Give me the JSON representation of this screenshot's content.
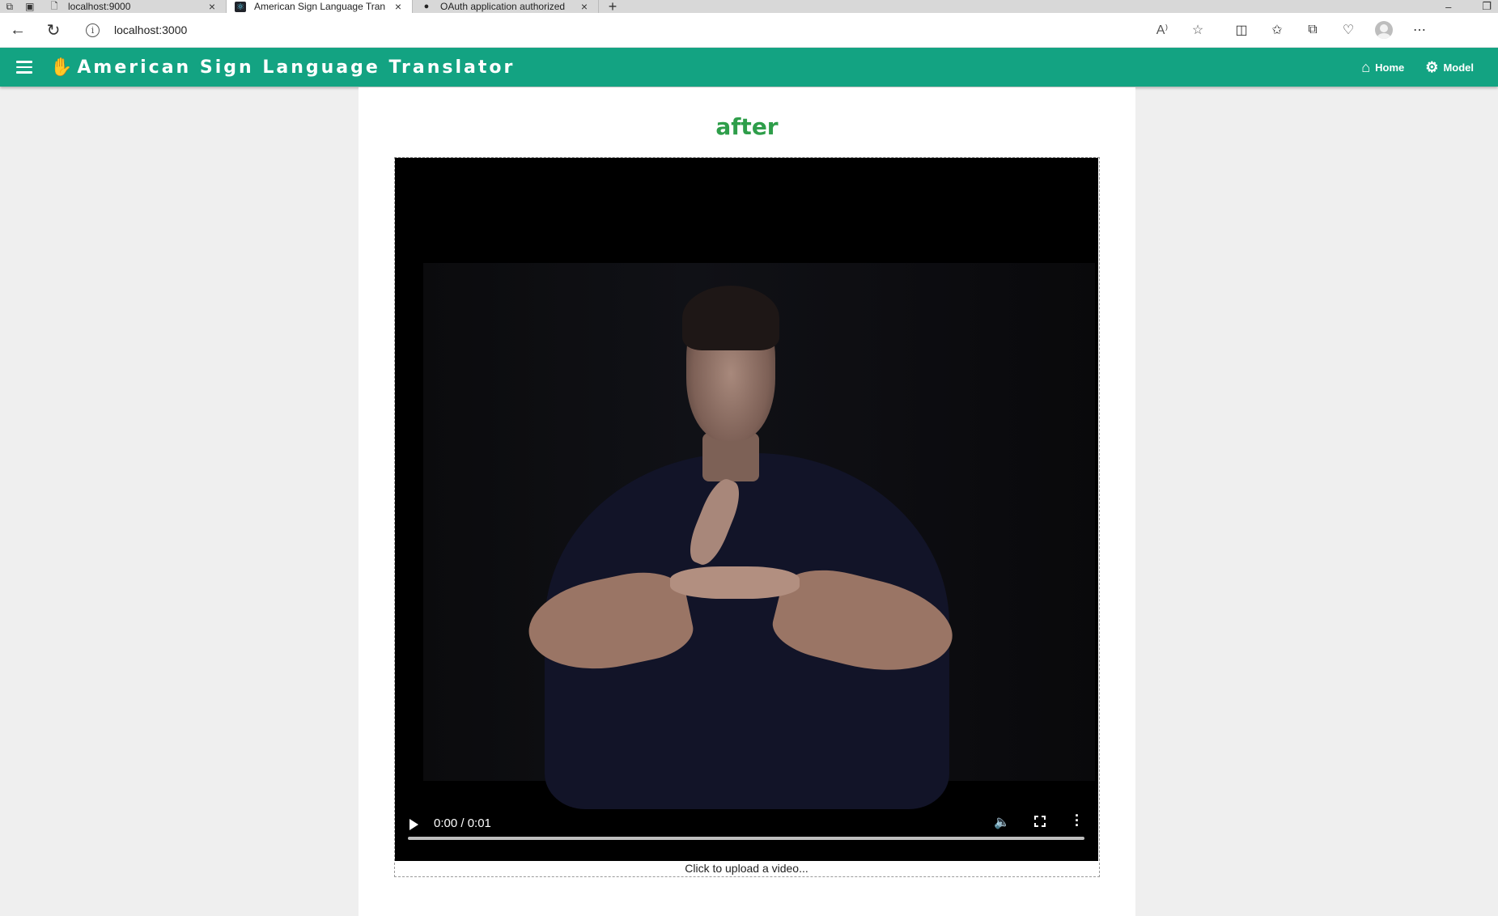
{
  "browser": {
    "tabs": [
      {
        "title": "localhost:9000",
        "icon": "page-icon",
        "active": false
      },
      {
        "title": "American Sign Language Tran",
        "icon": "react-icon",
        "active": true
      },
      {
        "title": "OAuth application authorized",
        "icon": "github-icon",
        "active": false
      }
    ],
    "new_tab_label": "+",
    "address": "localhost:3000"
  },
  "app": {
    "brand_icon": "hand-icon",
    "title": "American Sign Language Translator",
    "nav": [
      {
        "label": "Home",
        "icon": "home-icon"
      },
      {
        "label": "Model",
        "icon": "model-icon"
      }
    ],
    "accent_color": "#13a382",
    "title_color": "#2e9e4a"
  },
  "main": {
    "heading": "after",
    "video": {
      "current_time": "0:00",
      "duration": "0:01",
      "time_display": "0:00 / 0:01",
      "progress": 0
    },
    "upload_label": "Click to upload a video..."
  }
}
